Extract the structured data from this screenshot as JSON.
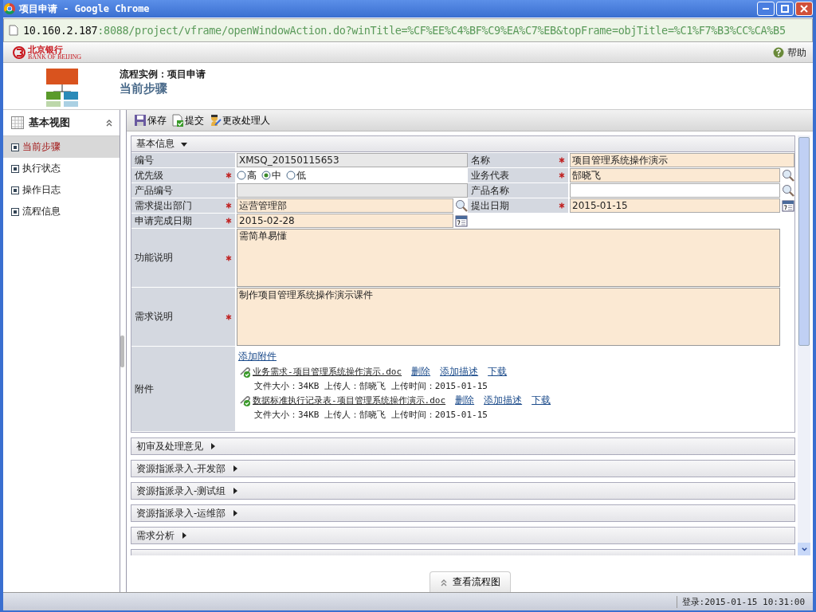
{
  "window": {
    "title": "项目申请 - Google Chrome"
  },
  "address_bar": {
    "host": "10.160.2.187",
    "path": ":8088/project/vframe/openWindowAction.do?winTitle=%CF%EE%C4%BF%C9%EA%C7%EB&topFrame=objTitle=%C1%F7%B3%CC%CA%B5"
  },
  "brand": {
    "name": "北京银行",
    "subtitle": "BANK OF BEIJING",
    "help": "帮助"
  },
  "page_header": {
    "caption": "流程实例：项目申请",
    "title": "当前步骤"
  },
  "sidebar": {
    "title": "基本视图",
    "items": [
      {
        "label": "当前步骤",
        "selected": true
      },
      {
        "label": "执行状态",
        "selected": false
      },
      {
        "label": "操作日志",
        "selected": false
      },
      {
        "label": "流程信息",
        "selected": false
      }
    ]
  },
  "toolbar": [
    {
      "kind": "save",
      "label": "保存"
    },
    {
      "kind": "submit",
      "label": "提交"
    },
    {
      "kind": "assign",
      "label": "更改处理人"
    }
  ],
  "basic_info": {
    "title": "基本信息",
    "expanded": true,
    "rows": [
      [
        {
          "label": "编号",
          "required": false,
          "readonly": true,
          "kind": "text",
          "value": "XMSQ_20150115653"
        },
        {
          "label": "名称",
          "required": true,
          "readonly": false,
          "kind": "text",
          "value": "项目管理系统操作演示"
        }
      ],
      [
        {
          "label": "优先级",
          "required": true,
          "kind": "radio",
          "options": [
            {
              "label": "高",
              "selected": false
            },
            {
              "label": "中",
              "selected": true
            },
            {
              "label": "低",
              "selected": false
            }
          ]
        },
        {
          "label": "业务代表",
          "required": true,
          "readonly": false,
          "kind": "text",
          "value": "郜晓飞",
          "lookup": true
        }
      ],
      [
        {
          "label": "产品编号",
          "required": false,
          "readonly": true,
          "kind": "text"
        },
        {
          "label": "产品名称",
          "required": false,
          "readonly": false,
          "kind": "text",
          "lookup": true
        }
      ],
      [
        {
          "label": "需求提出部门",
          "required": true,
          "readonly": false,
          "kind": "text",
          "value": "运营管理部",
          "lookup": true
        },
        {
          "label": "提出日期",
          "required": true,
          "readonly": false,
          "kind": "text",
          "value": "2015-01-15",
          "date_picker": true
        }
      ],
      [
        {
          "label": "申请完成日期",
          "required": true,
          "readonly": false,
          "kind": "text",
          "value": "2015-02-28",
          "date_picker": true
        }
      ]
    ],
    "textareas": [
      {
        "label": "功能说明",
        "required": true,
        "value": "需简单易懂"
      },
      {
        "label": "需求说明",
        "required": true,
        "value": "制作项目管理系统操作演示课件"
      }
    ],
    "attachments": {
      "label": "附件",
      "add_link": "添加附件",
      "files": [
        {
          "name": "业务需求-项目管理系统操作演示.doc",
          "actions": [
            "删除",
            "添加描述",
            "下载"
          ],
          "info": "文件大小：34KB 上传人：郜晓飞 上传时间：2015-01-15"
        },
        {
          "name": "数据标准执行记录表-项目管理系统操作演示.doc",
          "actions": [
            "删除",
            "添加描述",
            "下载"
          ],
          "info": "文件大小：34KB 上传人：郜晓飞 上传时间：2015-01-15"
        }
      ]
    }
  },
  "sections": [
    {
      "title": "初审及处理意见",
      "expanded": false
    },
    {
      "title": "资源指派录入-开发部",
      "expanded": false
    },
    {
      "title": "资源指派录入-测试组",
      "expanded": false
    },
    {
      "title": "资源指派录入-运维部",
      "expanded": false
    },
    {
      "title": "需求分析",
      "expanded": false
    }
  ],
  "flow_button": "查看流程图",
  "status_bar": {
    "login": "登录:2015-01-15 10:31:00"
  }
}
